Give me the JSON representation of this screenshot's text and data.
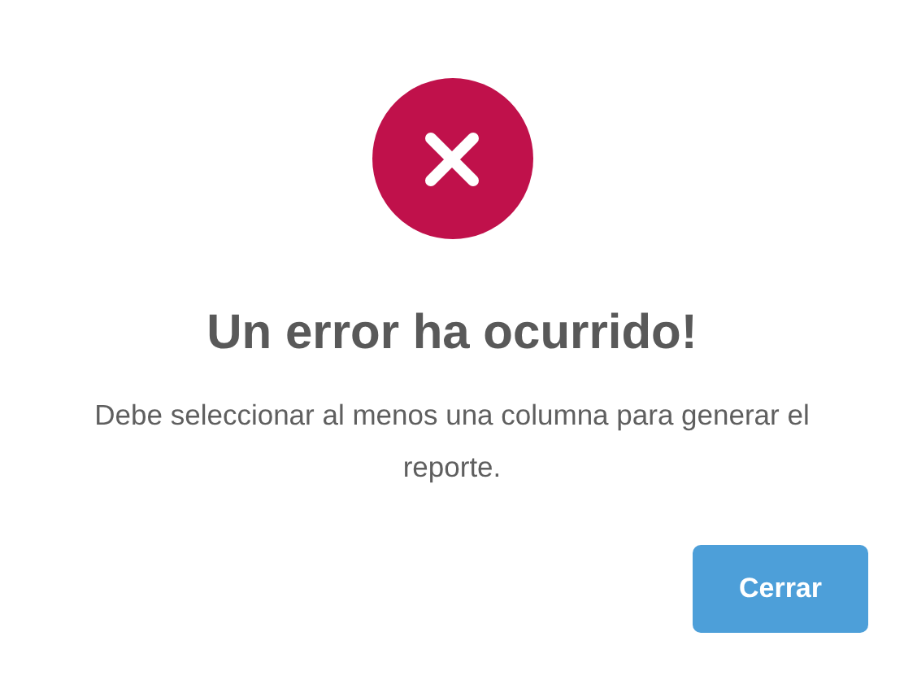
{
  "dialog": {
    "title": "Un error ha ocurrido!",
    "message": "Debe seleccionar al menos una columna para generar el reporte.",
    "buttons": [
      {
        "label": "Cerrar"
      }
    ]
  }
}
